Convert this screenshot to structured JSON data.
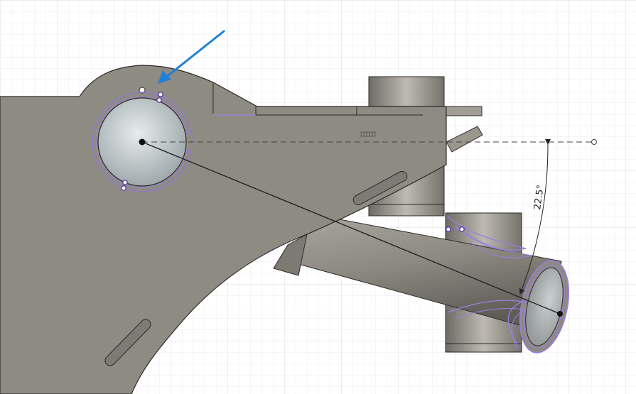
{
  "viewport": {
    "background": "#ffffff",
    "grid_minor": "#eeeeee",
    "grid_major": "#dcdcdc"
  },
  "model": {
    "body_color": "#8e8b83",
    "body_edge": "#2b2a28",
    "tube_light": "#b3b0a8",
    "tube_dark": "#6f6c65",
    "bore_color": "#c8d2d4"
  },
  "sketch": {
    "profile_color": "#9b7fe0",
    "constraint_point_color": "#5a3ea6",
    "guide_line_color": "#444444"
  },
  "dimension": {
    "angle_label": "22.5°",
    "color": "#222222"
  },
  "annotation": {
    "arrow_color": "#1f7fd6"
  }
}
